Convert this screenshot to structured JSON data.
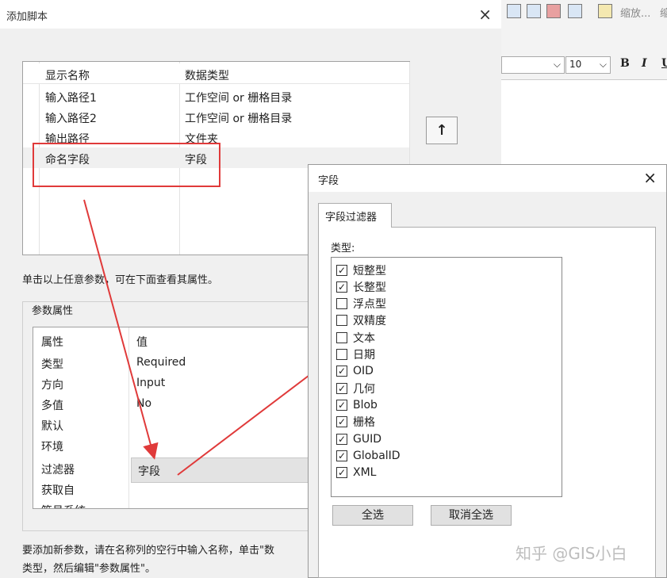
{
  "app": {
    "zoom_label": "缩放...",
    "zoom_label2": "缩",
    "font_size": "10",
    "bold": "B",
    "italic": "I",
    "underline": "U"
  },
  "main_dialog": {
    "title": "添加脚本",
    "close": "×",
    "grid": {
      "headers": [
        "显示名称",
        "数据类型"
      ],
      "rows": [
        [
          "输入路径1",
          "工作空间 or 栅格目录"
        ],
        [
          "输入路径2",
          "工作空间 or 栅格目录"
        ],
        [
          "输出路径",
          "文件夹"
        ],
        [
          "命名字段",
          "字段"
        ]
      ]
    },
    "move_up": "↑",
    "help_text": "单击以上任意参数，可在下面查看其属性。",
    "props_group_title": "参数属性",
    "props": {
      "headers": [
        "属性",
        "值"
      ],
      "rows": [
        [
          "类型",
          "Required"
        ],
        [
          "方向",
          "Input"
        ],
        [
          "多值",
          "No"
        ],
        [
          "默认",
          ""
        ],
        [
          "环境",
          ""
        ],
        [
          "过滤器",
          "字段"
        ],
        [
          "获取自",
          ""
        ],
        [
          "符号系统",
          ""
        ]
      ]
    },
    "footer_line1": "要添加新参数，请在名称列的空行中输入名称，单击\"数",
    "footer_line2": "类型，然后编辑\"参数属性\"。"
  },
  "field_dialog": {
    "title": "字段",
    "close": "×",
    "tab": "字段过滤器",
    "type_label": "类型:",
    "types": [
      {
        "label": "短整型",
        "checked": true
      },
      {
        "label": "长整型",
        "checked": true
      },
      {
        "label": "浮点型",
        "checked": false
      },
      {
        "label": "双精度",
        "checked": false
      },
      {
        "label": "文本",
        "checked": false
      },
      {
        "label": "日期",
        "checked": false
      },
      {
        "label": "OID",
        "checked": true
      },
      {
        "label": "几何",
        "checked": true
      },
      {
        "label": "Blob",
        "checked": true
      },
      {
        "label": "栅格",
        "checked": true
      },
      {
        "label": "GUID",
        "checked": true
      },
      {
        "label": "GlobalID",
        "checked": true
      },
      {
        "label": "XML",
        "checked": true
      }
    ],
    "select_all": "全选",
    "deselect_all": "取消全选"
  },
  "watermark": "知乎 @GIS小白",
  "colors": {
    "highlight": "#e03a3a"
  }
}
